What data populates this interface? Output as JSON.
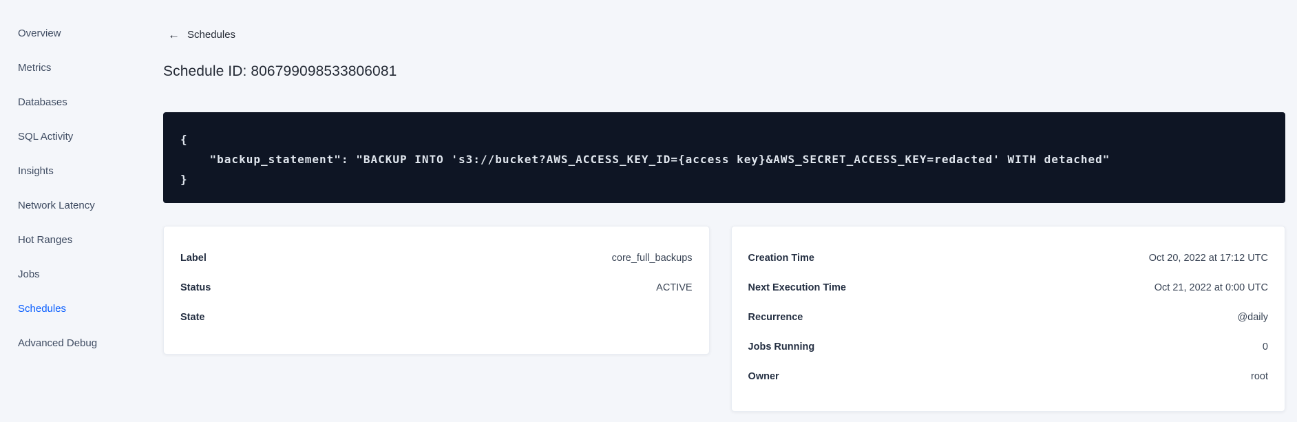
{
  "colors": {
    "background": "#f4f6fa",
    "active_link": "#0b5fff",
    "code_background": "#0e1524",
    "code_text": "#e0e6ee",
    "card_background": "#ffffff",
    "text_dark": "#242a35"
  },
  "sidebar": {
    "items": [
      {
        "label": "Overview",
        "active": false
      },
      {
        "label": "Metrics",
        "active": false
      },
      {
        "label": "Databases",
        "active": false
      },
      {
        "label": "SQL Activity",
        "active": false
      },
      {
        "label": "Insights",
        "active": false
      },
      {
        "label": "Network Latency",
        "active": false
      },
      {
        "label": "Hot Ranges",
        "active": false
      },
      {
        "label": "Jobs",
        "active": false
      },
      {
        "label": "Schedules",
        "active": true
      },
      {
        "label": "Advanced Debug",
        "active": false
      }
    ]
  },
  "header": {
    "back_icon": "arrow-left",
    "back_arrow_glyph": "←",
    "back_label": "Schedules",
    "title": "Schedule ID: 806799098533806081"
  },
  "code_block": {
    "text": "{\n    \"backup_statement\": \"BACKUP INTO 's3://bucket?AWS_ACCESS_KEY_ID={access key}&AWS_SECRET_ACCESS_KEY=redacted' WITH detached\"\n}"
  },
  "details_left": {
    "rows": [
      {
        "label": "Label",
        "value": "core_full_backups"
      },
      {
        "label": "Status",
        "value": "ACTIVE"
      },
      {
        "label": "State",
        "value": ""
      }
    ]
  },
  "details_right": {
    "rows": [
      {
        "label": "Creation Time",
        "value": "Oct 20, 2022 at 17:12 UTC"
      },
      {
        "label": "Next Execution Time",
        "value": "Oct 21, 2022 at 0:00 UTC"
      },
      {
        "label": "Recurrence",
        "value": "@daily"
      },
      {
        "label": "Jobs Running",
        "value": "0"
      },
      {
        "label": "Owner",
        "value": "root"
      }
    ]
  }
}
